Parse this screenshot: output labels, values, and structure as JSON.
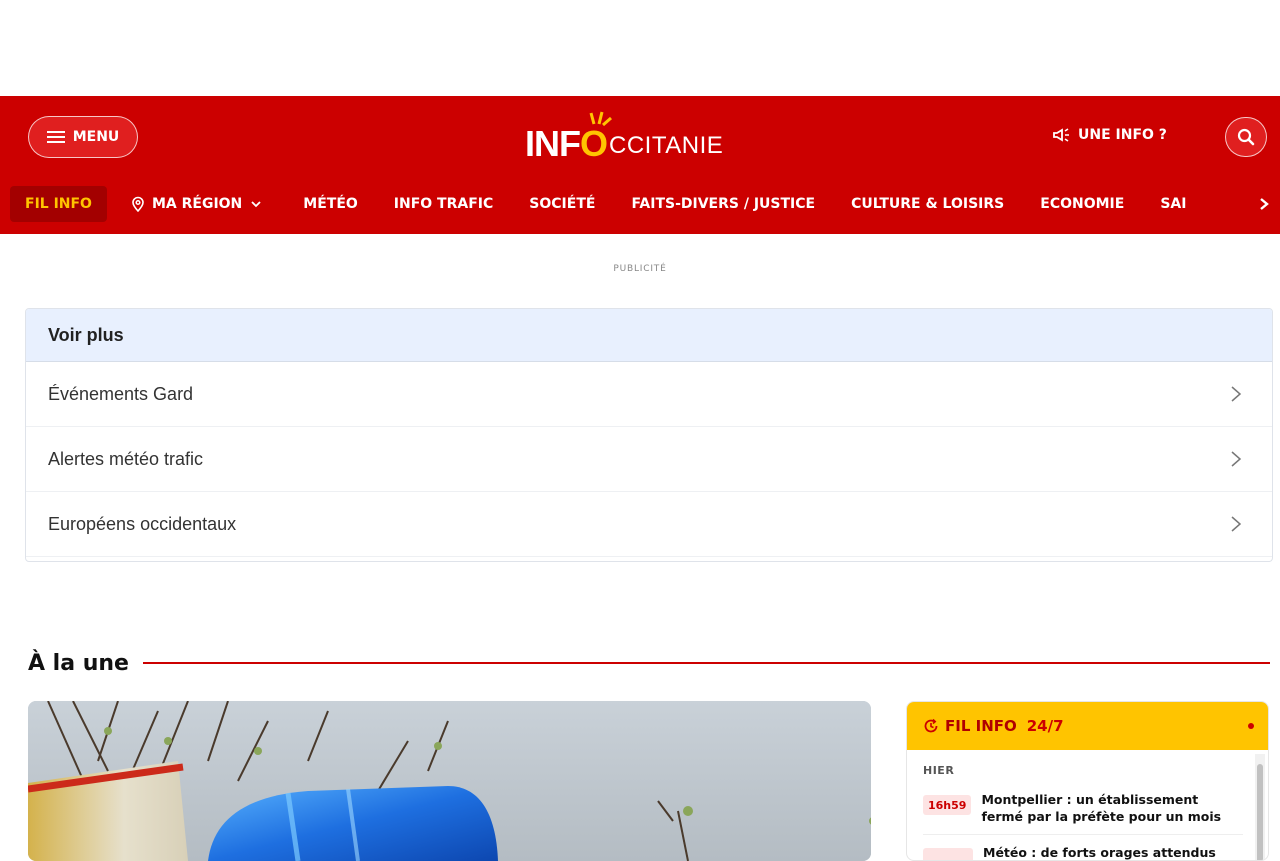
{
  "header": {
    "menu_label": "MENU",
    "logo_info": "INF",
    "logo_o": "O",
    "logo_rest": "CCITANIE",
    "une_info_label": "UNE INFO ?"
  },
  "nav": {
    "items": [
      {
        "label": "FIL INFO",
        "active": true
      },
      {
        "label": "MA RÉGION"
      },
      {
        "label": "MÉTÉO"
      },
      {
        "label": "INFO TRAFIC"
      },
      {
        "label": "SOCIÉTÉ"
      },
      {
        "label": "FAITS-DIVERS / JUSTICE"
      },
      {
        "label": "CULTURE & LOISIRS"
      },
      {
        "label": "ECONOMIE"
      },
      {
        "label": "SAI"
      }
    ]
  },
  "ad": {
    "label": "PUBLICITÉ"
  },
  "voir_plus": {
    "title": "Voir plus",
    "items": [
      "Événements Gard",
      "Alertes météo trafic",
      "Européens occidentaux"
    ]
  },
  "une": {
    "title": "À la une"
  },
  "fil_info": {
    "title": "FIL INFO",
    "badge": "24/7",
    "day": "HIER",
    "items": [
      {
        "time": "16h59",
        "text": "Montpellier : un établissement fermé par la préfète pour un mois"
      },
      {
        "time": "",
        "text": "Météo : de forts orages attendus"
      }
    ]
  },
  "colors": {
    "brand_red": "#cc0000",
    "accent_yellow": "#ffc400",
    "voir_plus_header": "#e8f0fe"
  }
}
